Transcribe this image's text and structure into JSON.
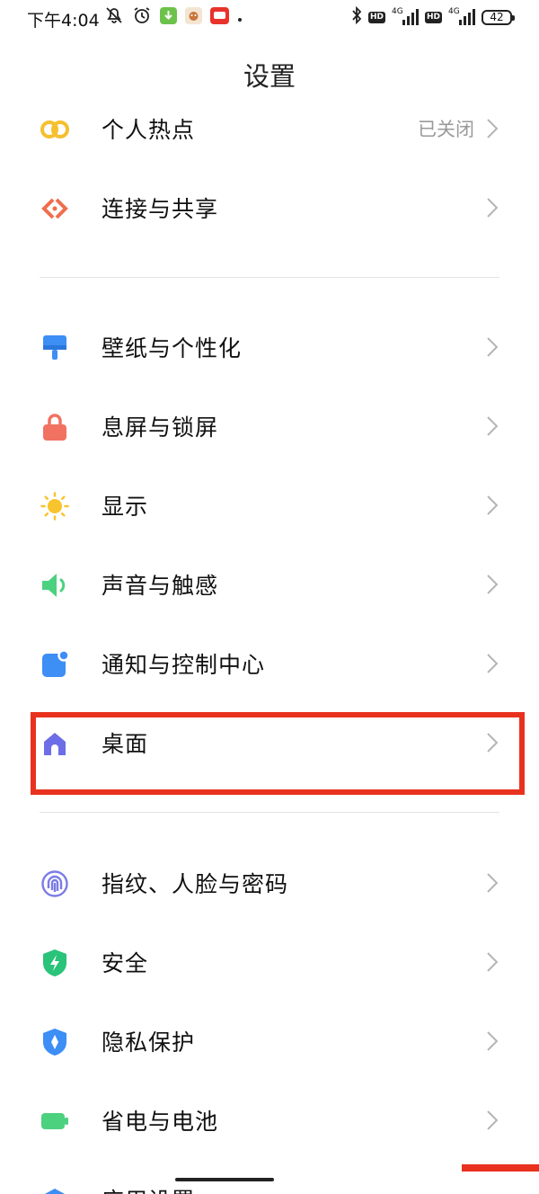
{
  "status_bar": {
    "time": "下午4:04",
    "left_icons": [
      "mute-icon",
      "alarm-icon",
      "download-app-icon",
      "app-icon",
      "app-icon",
      "dot-icon"
    ],
    "network_1": {
      "badge": "HD",
      "type": "4G"
    },
    "network_2": {
      "badge": "HD",
      "type": "4G"
    },
    "battery": "42"
  },
  "header": {
    "title": "设置"
  },
  "sections": [
    {
      "items": [
        {
          "id": "hotspot",
          "label": "个人热点",
          "value": "已关闭",
          "icon": "link-icon",
          "color": "#f5c02f"
        },
        {
          "id": "connection",
          "label": "连接与共享",
          "value": "",
          "icon": "connection-icon",
          "color": "#f06e4e"
        }
      ]
    },
    {
      "items": [
        {
          "id": "wallpaper",
          "label": "壁纸与个性化",
          "icon": "brush-icon",
          "color": "#3d8ef5"
        },
        {
          "id": "lockscreen",
          "label": "息屏与锁屏",
          "icon": "lock-icon",
          "color": "#f27261"
        },
        {
          "id": "display",
          "label": "显示",
          "icon": "sun-icon",
          "color": "#f7c42e"
        },
        {
          "id": "sound",
          "label": "声音与触感",
          "icon": "speaker-icon",
          "color": "#4cd17f"
        },
        {
          "id": "notification",
          "label": "通知与控制中心",
          "icon": "notification-icon",
          "color": "#3d8ef5"
        },
        {
          "id": "desktop",
          "label": "桌面",
          "icon": "home-icon",
          "color": "#6d6de8"
        }
      ]
    },
    {
      "items": [
        {
          "id": "fingerprint",
          "label": "指纹、人脸与密码",
          "icon": "fingerprint-icon",
          "color": "#7b7be8"
        },
        {
          "id": "security",
          "label": "安全",
          "icon": "shield-icon",
          "color": "#29c37a"
        },
        {
          "id": "privacy",
          "label": "隐私保护",
          "icon": "privacy-icon",
          "color": "#3d8ef5"
        },
        {
          "id": "battery",
          "label": "省电与电池",
          "icon": "battery-icon",
          "color": "#4cd17f"
        },
        {
          "id": "apps",
          "label": "应用设置",
          "icon": "apps-icon",
          "color": "#3d8ef5"
        }
      ]
    }
  ],
  "accent_highlight_color": "#e8321f"
}
